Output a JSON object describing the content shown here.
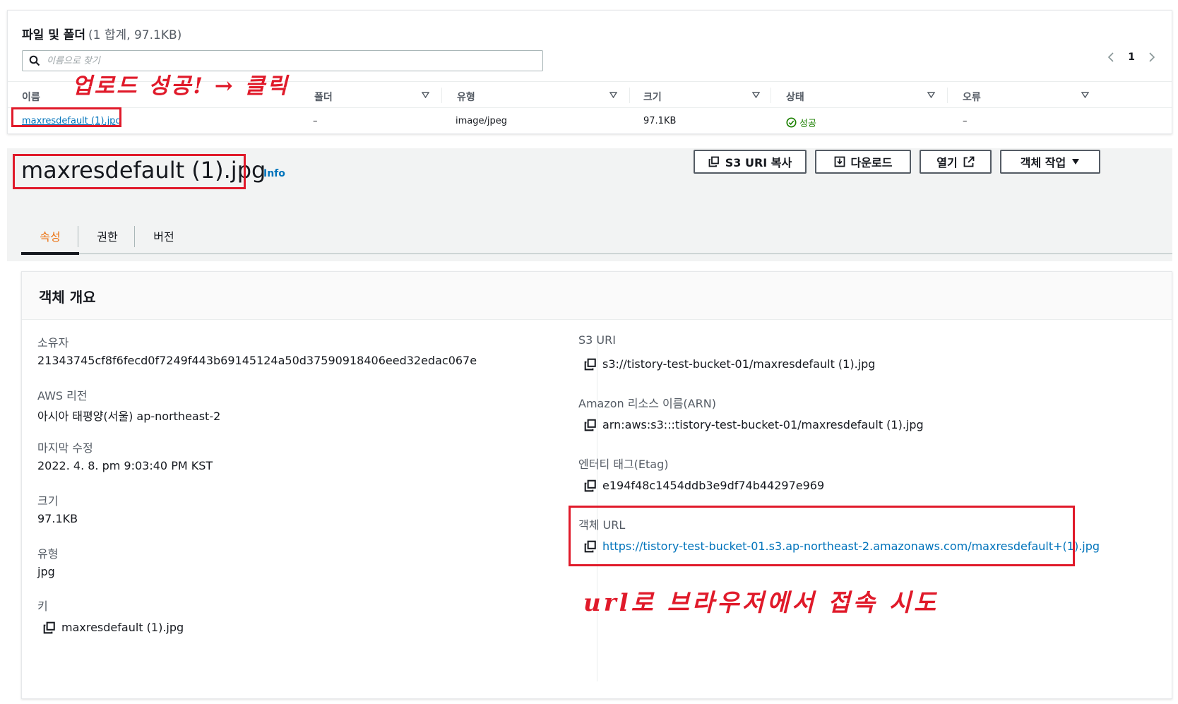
{
  "files": {
    "title": "파일 및 폴더",
    "count": "(1 합계, 97.1KB)",
    "search_placeholder": "이름으로 찾기",
    "page": "1",
    "columns": [
      "이름",
      "폴더",
      "유형",
      "크기",
      "상태",
      "오류"
    ],
    "row": {
      "name": "maxresdefault (1).jpg",
      "folder": "–",
      "type": "image/jpeg",
      "size": "97.1KB",
      "status": "성공",
      "error": "–"
    },
    "annotation": "업로드 성공! → 클릭"
  },
  "object": {
    "title": "maxresdefault (1).jpg",
    "info": "Info",
    "buttons": {
      "copy_uri": "S3 URI 복사",
      "download": "다운로드",
      "open": "열기",
      "actions": "객체 작업"
    },
    "tabs": [
      "속성",
      "권한",
      "버전"
    ]
  },
  "overview": {
    "title": "객체 개요",
    "left": [
      {
        "label": "소유자",
        "value": "21343745cf8f6fecd0f7249f443b69145124a50d37590918406eed32edac067e"
      },
      {
        "label": "AWS 리전",
        "value": "아시아 태평양(서울) ap-northeast-2"
      },
      {
        "label": "마지막 수정",
        "value": "2022. 4. 8. pm 9:03:40 PM KST"
      },
      {
        "label": "크기",
        "value": "97.1KB"
      },
      {
        "label": "유형",
        "value": "jpg"
      },
      {
        "label": "키",
        "value": "maxresdefault (1).jpg"
      }
    ],
    "right": [
      {
        "label": "S3 URI",
        "value": "s3://tistory-test-bucket-01/maxresdefault (1).jpg"
      },
      {
        "label": "Amazon 리소스 이름(ARN)",
        "value": "arn:aws:s3:::tistory-test-bucket-01/maxresdefault (1).jpg"
      },
      {
        "label": "엔터티 태그(Etag)",
        "value": "e194f48c1454ddb3e9df74b44297e969"
      },
      {
        "label": "객체 URL",
        "value": "https://tistory-test-bucket-01.s3.ap-northeast-2.amazonaws.com/maxresdefault+(1).jpg"
      }
    ],
    "annotation": "url로 브라우저에서 접속 시도"
  },
  "colors": {
    "link": "#0073bb",
    "active_tab": "#ec7211",
    "success": "#1d8102",
    "annotation": "#e01a2a"
  }
}
